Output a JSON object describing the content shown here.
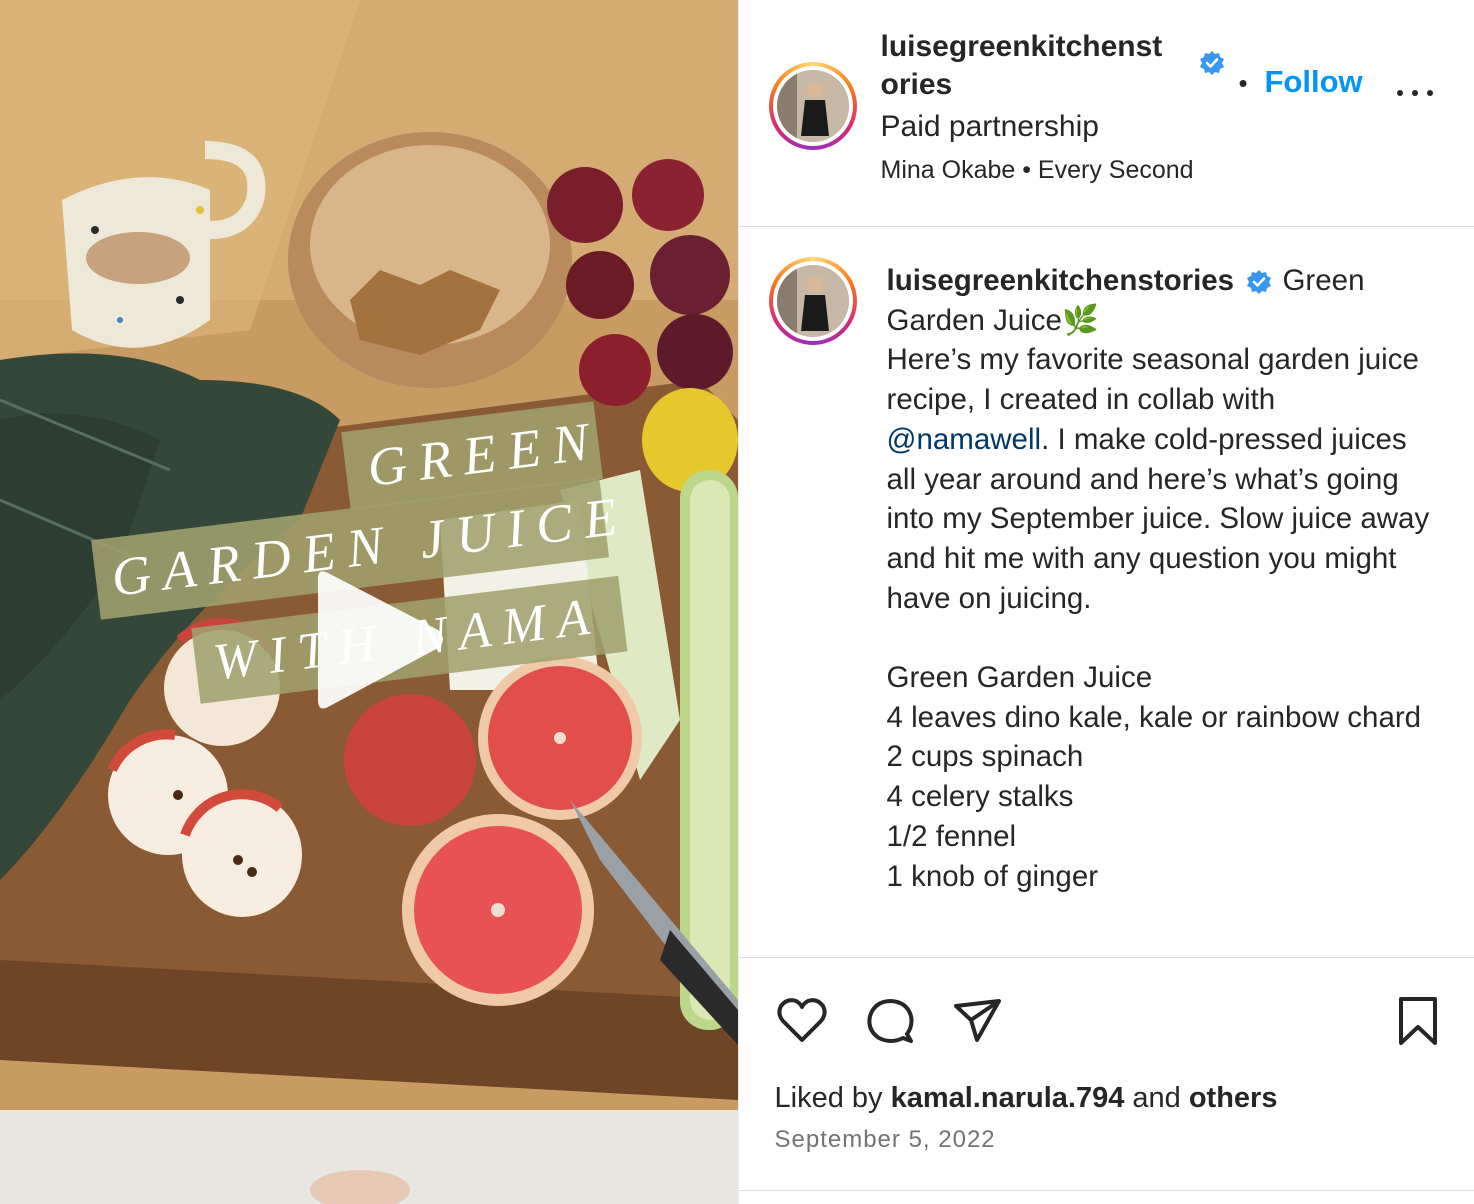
{
  "media": {
    "overlay_line1": "GREEN",
    "overlay_line2": "GARDEN JUICE",
    "overlay_line3": "WITH NAMA"
  },
  "header": {
    "username": "luisegreenkitchenstories",
    "follow_label": "Follow",
    "separator": "•",
    "partnership": "Paid partnership",
    "audio": "Mina Okabe • Every Second"
  },
  "caption": {
    "username": "luisegreenkitchenstories",
    "title": "Green Garden Juice🌿",
    "intro_before_mention": "Here’s my favorite seasonal garden juice recipe, I created in collab with ",
    "mention": "@namawell",
    "intro_after_mention": ". I make cold-pressed juices all year around and here’s what’s going into my September juice. Slow juice away and hit me with any question you might have on juicing.",
    "recipe_title": "Green Garden Juice",
    "ingredients": [
      "4 leaves dino kale, kale or rainbow chard",
      "2 cups spinach",
      "4 celery stalks",
      "1/2 fennel",
      "1 knob of ginger"
    ]
  },
  "likes": {
    "prefix": "Liked by ",
    "user": "kamal.narula.794",
    "middle": " and ",
    "others": "others"
  },
  "date": "September 5, 2022",
  "colors": {
    "follow": "#0095f6",
    "mention": "#00376b",
    "verified": "#3897f0"
  },
  "icons": [
    "verified-badge-icon",
    "play-icon",
    "heart-icon",
    "comment-icon",
    "share-icon",
    "bookmark-icon",
    "more-icon"
  ]
}
